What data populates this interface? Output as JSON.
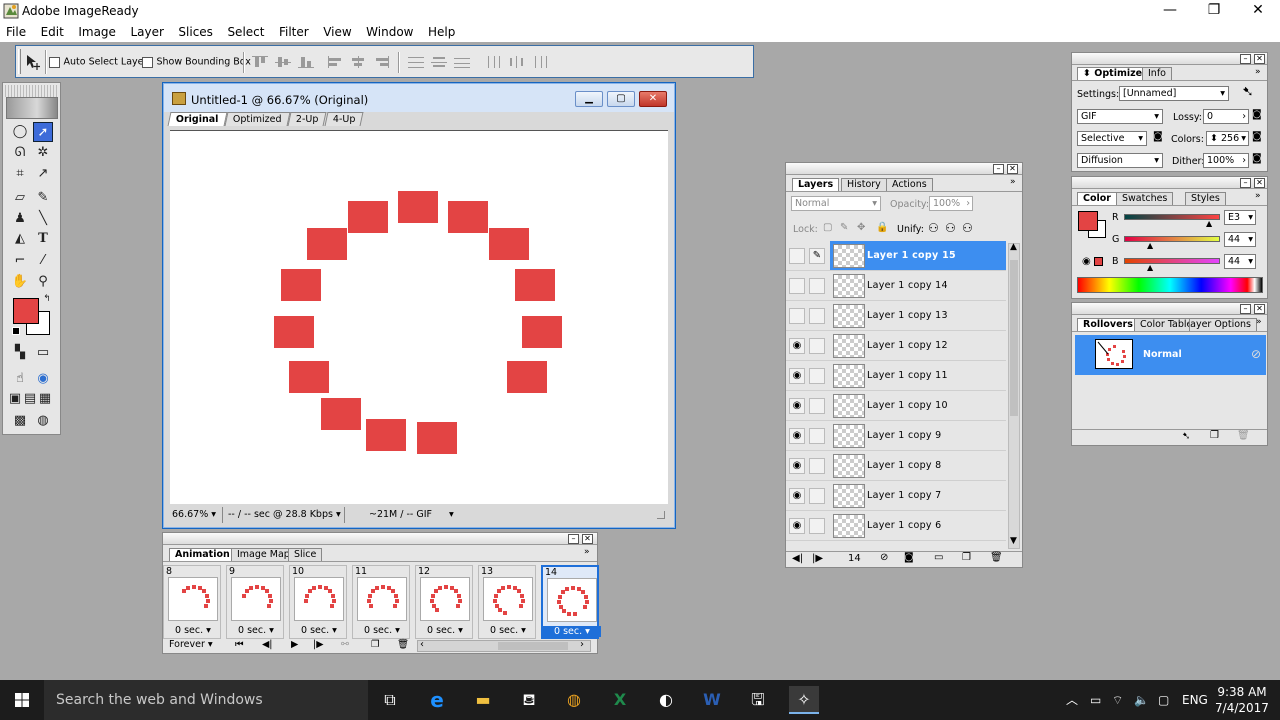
{
  "app": {
    "title": "Adobe ImageReady",
    "menu": [
      "File",
      "Edit",
      "Image",
      "Layer",
      "Slices",
      "Select",
      "Filter",
      "View",
      "Window",
      "Help"
    ]
  },
  "window_controls": {
    "minimize": "—",
    "restore": "❐",
    "close": "✕"
  },
  "options_bar": {
    "auto_select_layer": "Auto Select Layer",
    "show_bounding_box": "Show Bounding Box"
  },
  "colors": {
    "accent": "#e34444",
    "selection": "#3d8ef0",
    "window_border": "#1565c0"
  },
  "document": {
    "title": "Untitled-1 @ 66.67% (Original)",
    "tabs": [
      "Original",
      "Optimized",
      "2-Up",
      "4-Up"
    ],
    "active_tab": "Original",
    "status": {
      "zoom": "66.67%",
      "download": "-- / -- sec @ 28.8 Kbps",
      "info": "~21M / -- GIF"
    },
    "loader_squares": 14
  },
  "animation": {
    "tabs": [
      "Animation",
      "Image Map",
      "Slice"
    ],
    "frames": [
      {
        "num": "8",
        "delay": "0 sec.",
        "dots": 8
      },
      {
        "num": "9",
        "delay": "0 sec.",
        "dots": 9
      },
      {
        "num": "10",
        "delay": "0 sec.",
        "dots": 10
      },
      {
        "num": "11",
        "delay": "0 sec.",
        "dots": 11
      },
      {
        "num": "12",
        "delay": "0 sec.",
        "dots": 12
      },
      {
        "num": "13",
        "delay": "0 sec.",
        "dots": 13
      },
      {
        "num": "14",
        "delay": "0 sec.",
        "dots": 14
      }
    ],
    "selected_frame": "14",
    "loop": "Forever"
  },
  "layers": {
    "tabs": [
      "Layers",
      "History",
      "Actions"
    ],
    "blend_mode": "Normal",
    "opacity_label": "Opacity:",
    "opacity_value": "100%",
    "lock_label": "Lock:",
    "unify_label": "Unify:",
    "frame_count": "14",
    "rows": [
      {
        "name": "Layer 1 copy 15",
        "visible": false,
        "selected": true
      },
      {
        "name": "Layer 1 copy 14",
        "visible": false,
        "selected": false
      },
      {
        "name": "Layer 1 copy 13",
        "visible": false,
        "selected": false
      },
      {
        "name": "Layer 1 copy 12",
        "visible": true,
        "selected": false
      },
      {
        "name": "Layer 1 copy 11",
        "visible": true,
        "selected": false
      },
      {
        "name": "Layer 1 copy 10",
        "visible": true,
        "selected": false
      },
      {
        "name": "Layer 1 copy 9",
        "visible": true,
        "selected": false
      },
      {
        "name": "Layer 1 copy 8",
        "visible": true,
        "selected": false
      },
      {
        "name": "Layer 1 copy 7",
        "visible": true,
        "selected": false
      },
      {
        "name": "Layer 1 copy 6",
        "visible": true,
        "selected": false
      }
    ]
  },
  "optimize": {
    "tabs": [
      "Optimize",
      "Info"
    ],
    "settings_label": "Settings:",
    "settings_value": "[Unnamed]",
    "format": "GIF",
    "lossy_label": "Lossy:",
    "lossy_value": "0",
    "palette": "Selective",
    "colors_label": "Colors:",
    "colors_value": "256",
    "dither_algo": "Diffusion",
    "dither_label": "Dither:",
    "dither_value": "100%"
  },
  "color": {
    "tabs": [
      "Color",
      "Swatches",
      "Styles"
    ],
    "r_label": "R",
    "r_value": "E3",
    "g_label": "G",
    "g_value": "44",
    "b_label": "B",
    "b_value": "44",
    "r_level": 0.89,
    "g_level": 0.27,
    "b_level": 0.27,
    "swatch": "#e34444"
  },
  "rollovers": {
    "tabs": [
      "Rollovers",
      "Color Table",
      "Layer Options"
    ],
    "state": "Normal"
  },
  "taskbar": {
    "search_placeholder": "Search the web and Windows",
    "lang": "ENG",
    "time": "9:38 AM",
    "date": "7/4/2017"
  }
}
